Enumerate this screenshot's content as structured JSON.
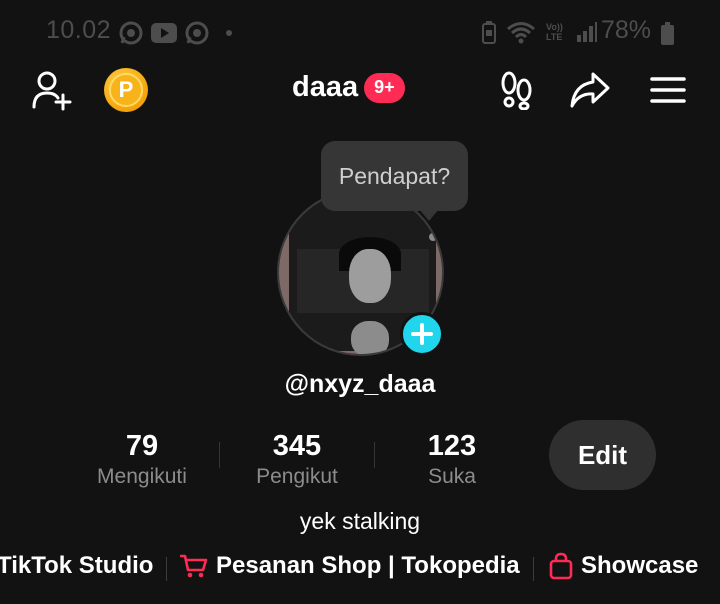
{
  "status_bar": {
    "time": "10.02",
    "battery_percent": "78%",
    "icons_left": [
      "whatsapp-icon",
      "youtube-icon",
      "whatsapp-icon",
      "dot-icon"
    ],
    "icons_right": [
      "battery-saver-icon",
      "wifi-icon",
      "volte-icon",
      "signal-icon"
    ],
    "volte_label": "Vo)) LTE"
  },
  "header": {
    "left_icons": [
      "add-friend-icon",
      "coin-icon"
    ],
    "coin_label": "P",
    "username": "daaa",
    "badge": "9+",
    "right_icons": [
      "footprints-icon",
      "share-icon",
      "menu-icon"
    ]
  },
  "tooltip": {
    "text": "Pendapat?"
  },
  "profile": {
    "handle": "@nxyz_daaa",
    "bio": "yek stalking",
    "edit_label": "Edit"
  },
  "stats": [
    {
      "value": "79",
      "label": "Mengikuti"
    },
    {
      "value": "345",
      "label": "Pengikut"
    },
    {
      "value": "123",
      "label": "Suka"
    }
  ],
  "links": [
    {
      "label": "TikTok Studio"
    },
    {
      "label": "Pesanan Shop | Tokopedia",
      "icon": "cart-icon"
    },
    {
      "label": "Showcase",
      "icon": "shopping-bag-icon"
    }
  ],
  "colors": {
    "background": "#121212",
    "badge": "#fe2c55",
    "add_button": "#20d5ec",
    "coin": "#f7b319",
    "shop_icon": "#fe2c55"
  }
}
